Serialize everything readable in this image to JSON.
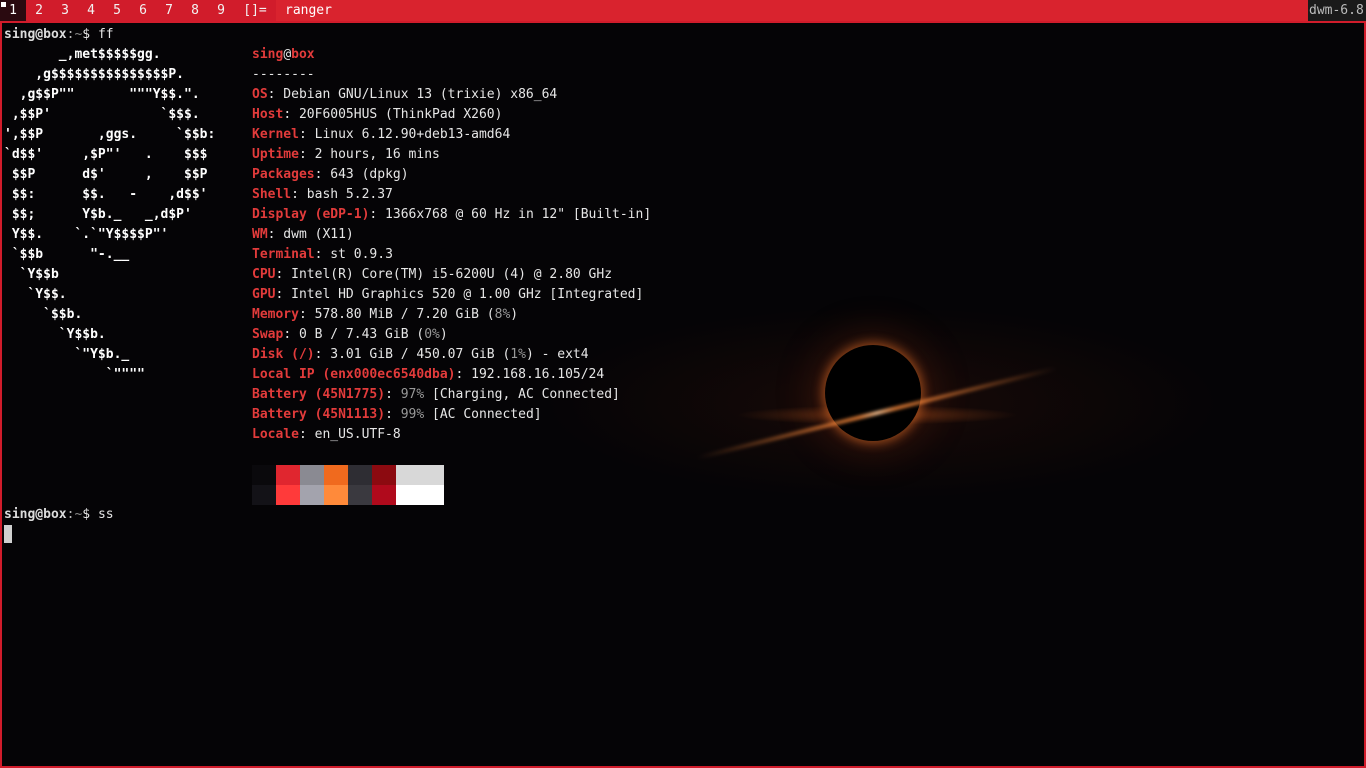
{
  "bar": {
    "tags": [
      "1",
      "2",
      "3",
      "4",
      "5",
      "6",
      "7",
      "8",
      "9"
    ],
    "selected_tag": "1",
    "layout_symbol": "[]=",
    "window_title": "ranger",
    "status_text": "dwm-6.8"
  },
  "terminal": {
    "prompt1": {
      "user": "sing@box",
      "sep": ":",
      "path": "~",
      "sym": "$",
      "command": "ff"
    },
    "prompt2": {
      "user": "sing@box",
      "sep": ":",
      "path": "~",
      "sym": "$",
      "command": "ss"
    },
    "logo": [
      "       _,met$$$$$gg.",
      "    ,g$$$$$$$$$$$$$$$P.",
      "  ,g$$P\"\"       \"\"\"Y$$.\".",
      " ,$$P'              `$$$.",
      "',$$P       ,ggs.     `$$b:",
      "`d$$'     ,$P\"'   .    $$$",
      " $$P      d$'     ,    $$P",
      " $$:      $$.   -    ,d$$'",
      " $$;      Y$b._   _,d$P'",
      " Y$$.    `.`\"Y$$$$P\"'",
      " `$$b      \"-.__",
      "  `Y$$b",
      "   `Y$$.",
      "     `$$b.",
      "       `Y$$b.",
      "         `\"Y$b._",
      "             `\"\"\"\""
    ],
    "header": {
      "user": "sing",
      "at": "@",
      "host": "box",
      "underline": "--------"
    },
    "info": [
      {
        "key": "OS",
        "value": ": Debian GNU/Linux 13 (trixie) x86_64"
      },
      {
        "key": "Host",
        "value": ": 20F6005HUS (ThinkPad X260)"
      },
      {
        "key": "Kernel",
        "value": ": Linux 6.12.90+deb13-amd64"
      },
      {
        "key": "Uptime",
        "value": ": 2 hours, 16 mins"
      },
      {
        "key": "Packages",
        "value": ": 643 (dpkg)"
      },
      {
        "key": "Shell",
        "value": ": bash 5.2.37"
      },
      {
        "key": "Display (eDP-1)",
        "value": ": 1366x768 @ 60 Hz in 12\" [Built-in]"
      },
      {
        "key": "WM",
        "value": ": dwm (X11)"
      },
      {
        "key": "Terminal",
        "value": ": st 0.9.3"
      },
      {
        "key": "CPU",
        "value": ": Intel(R) Core(TM) i5-6200U (4) @ 2.80 GHz"
      },
      {
        "key": "GPU",
        "value": ": Intel HD Graphics 520 @ 1.00 GHz [Integrated]"
      },
      {
        "key": "Memory",
        "value": ": 578.80 MiB / 7.20 GiB (",
        "pct": "8%",
        "tail": ")"
      },
      {
        "key": "Swap",
        "value": ": 0 B / 7.43 GiB (",
        "pct": "0%",
        "tail": ")"
      },
      {
        "key": "Disk (/)",
        "value": ": 3.01 GiB / 450.07 GiB (",
        "pct": "1%",
        "tail": ") - ext4"
      },
      {
        "key": "Local IP (enx000ec6540dba)",
        "value": ": 192.168.16.105/24"
      },
      {
        "key": "Battery (45N1775)",
        "value": ": ",
        "pct": "97%",
        "tail": " [Charging, AC Connected]"
      },
      {
        "key": "Battery (45N1113)",
        "value": ": ",
        "pct": "99%",
        "tail": " [AC Connected]"
      },
      {
        "key": "Locale",
        "value": ": en_US.UTF-8"
      }
    ],
    "palette_top": [
      "#0a090c",
      "#e0262f",
      "#8a8a92",
      "#f06a1e",
      "#2e2d33",
      "#8c0a10",
      "#d8d8d8",
      "#d8d8d8"
    ],
    "palette_bottom": [
      "#131217",
      "#ff3a3a",
      "#a3a3ad",
      "#ff8a3a",
      "#3a393f",
      "#b00a1c",
      "#ffffff",
      "#ffffff"
    ]
  }
}
